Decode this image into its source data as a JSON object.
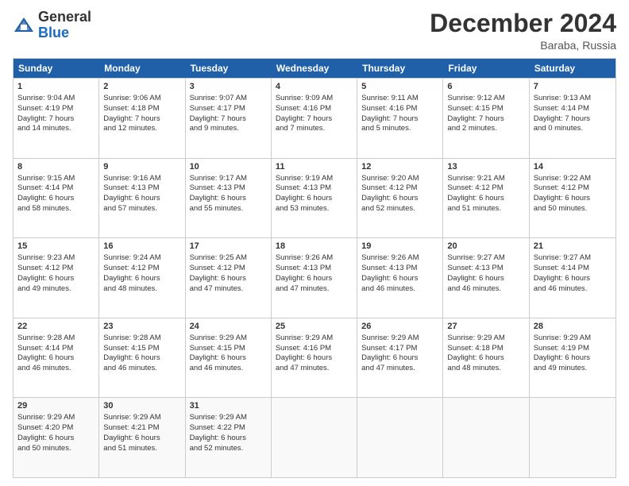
{
  "header": {
    "logo_general": "General",
    "logo_blue": "Blue",
    "month_title": "December 2024",
    "location": "Baraba, Russia"
  },
  "days_of_week": [
    "Sunday",
    "Monday",
    "Tuesday",
    "Wednesday",
    "Thursday",
    "Friday",
    "Saturday"
  ],
  "weeks": [
    [
      {
        "day": "1",
        "lines": [
          "Sunrise: 9:04 AM",
          "Sunset: 4:19 PM",
          "Daylight: 7 hours",
          "and 14 minutes."
        ]
      },
      {
        "day": "2",
        "lines": [
          "Sunrise: 9:06 AM",
          "Sunset: 4:18 PM",
          "Daylight: 7 hours",
          "and 12 minutes."
        ]
      },
      {
        "day": "3",
        "lines": [
          "Sunrise: 9:07 AM",
          "Sunset: 4:17 PM",
          "Daylight: 7 hours",
          "and 9 minutes."
        ]
      },
      {
        "day": "4",
        "lines": [
          "Sunrise: 9:09 AM",
          "Sunset: 4:16 PM",
          "Daylight: 7 hours",
          "and 7 minutes."
        ]
      },
      {
        "day": "5",
        "lines": [
          "Sunrise: 9:11 AM",
          "Sunset: 4:16 PM",
          "Daylight: 7 hours",
          "and 5 minutes."
        ]
      },
      {
        "day": "6",
        "lines": [
          "Sunrise: 9:12 AM",
          "Sunset: 4:15 PM",
          "Daylight: 7 hours",
          "and 2 minutes."
        ]
      },
      {
        "day": "7",
        "lines": [
          "Sunrise: 9:13 AM",
          "Sunset: 4:14 PM",
          "Daylight: 7 hours",
          "and 0 minutes."
        ]
      }
    ],
    [
      {
        "day": "8",
        "lines": [
          "Sunrise: 9:15 AM",
          "Sunset: 4:14 PM",
          "Daylight: 6 hours",
          "and 58 minutes."
        ]
      },
      {
        "day": "9",
        "lines": [
          "Sunrise: 9:16 AM",
          "Sunset: 4:13 PM",
          "Daylight: 6 hours",
          "and 57 minutes."
        ]
      },
      {
        "day": "10",
        "lines": [
          "Sunrise: 9:17 AM",
          "Sunset: 4:13 PM",
          "Daylight: 6 hours",
          "and 55 minutes."
        ]
      },
      {
        "day": "11",
        "lines": [
          "Sunrise: 9:19 AM",
          "Sunset: 4:13 PM",
          "Daylight: 6 hours",
          "and 53 minutes."
        ]
      },
      {
        "day": "12",
        "lines": [
          "Sunrise: 9:20 AM",
          "Sunset: 4:12 PM",
          "Daylight: 6 hours",
          "and 52 minutes."
        ]
      },
      {
        "day": "13",
        "lines": [
          "Sunrise: 9:21 AM",
          "Sunset: 4:12 PM",
          "Daylight: 6 hours",
          "and 51 minutes."
        ]
      },
      {
        "day": "14",
        "lines": [
          "Sunrise: 9:22 AM",
          "Sunset: 4:12 PM",
          "Daylight: 6 hours",
          "and 50 minutes."
        ]
      }
    ],
    [
      {
        "day": "15",
        "lines": [
          "Sunrise: 9:23 AM",
          "Sunset: 4:12 PM",
          "Daylight: 6 hours",
          "and 49 minutes."
        ]
      },
      {
        "day": "16",
        "lines": [
          "Sunrise: 9:24 AM",
          "Sunset: 4:12 PM",
          "Daylight: 6 hours",
          "and 48 minutes."
        ]
      },
      {
        "day": "17",
        "lines": [
          "Sunrise: 9:25 AM",
          "Sunset: 4:12 PM",
          "Daylight: 6 hours",
          "and 47 minutes."
        ]
      },
      {
        "day": "18",
        "lines": [
          "Sunrise: 9:26 AM",
          "Sunset: 4:13 PM",
          "Daylight: 6 hours",
          "and 47 minutes."
        ]
      },
      {
        "day": "19",
        "lines": [
          "Sunrise: 9:26 AM",
          "Sunset: 4:13 PM",
          "Daylight: 6 hours",
          "and 46 minutes."
        ]
      },
      {
        "day": "20",
        "lines": [
          "Sunrise: 9:27 AM",
          "Sunset: 4:13 PM",
          "Daylight: 6 hours",
          "and 46 minutes."
        ]
      },
      {
        "day": "21",
        "lines": [
          "Sunrise: 9:27 AM",
          "Sunset: 4:14 PM",
          "Daylight: 6 hours",
          "and 46 minutes."
        ]
      }
    ],
    [
      {
        "day": "22",
        "lines": [
          "Sunrise: 9:28 AM",
          "Sunset: 4:14 PM",
          "Daylight: 6 hours",
          "and 46 minutes."
        ]
      },
      {
        "day": "23",
        "lines": [
          "Sunrise: 9:28 AM",
          "Sunset: 4:15 PM",
          "Daylight: 6 hours",
          "and 46 minutes."
        ]
      },
      {
        "day": "24",
        "lines": [
          "Sunrise: 9:29 AM",
          "Sunset: 4:15 PM",
          "Daylight: 6 hours",
          "and 46 minutes."
        ]
      },
      {
        "day": "25",
        "lines": [
          "Sunrise: 9:29 AM",
          "Sunset: 4:16 PM",
          "Daylight: 6 hours",
          "and 47 minutes."
        ]
      },
      {
        "day": "26",
        "lines": [
          "Sunrise: 9:29 AM",
          "Sunset: 4:17 PM",
          "Daylight: 6 hours",
          "and 47 minutes."
        ]
      },
      {
        "day": "27",
        "lines": [
          "Sunrise: 9:29 AM",
          "Sunset: 4:18 PM",
          "Daylight: 6 hours",
          "and 48 minutes."
        ]
      },
      {
        "day": "28",
        "lines": [
          "Sunrise: 9:29 AM",
          "Sunset: 4:19 PM",
          "Daylight: 6 hours",
          "and 49 minutes."
        ]
      }
    ],
    [
      {
        "day": "29",
        "lines": [
          "Sunrise: 9:29 AM",
          "Sunset: 4:20 PM",
          "Daylight: 6 hours",
          "and 50 minutes."
        ]
      },
      {
        "day": "30",
        "lines": [
          "Sunrise: 9:29 AM",
          "Sunset: 4:21 PM",
          "Daylight: 6 hours",
          "and 51 minutes."
        ]
      },
      {
        "day": "31",
        "lines": [
          "Sunrise: 9:29 AM",
          "Sunset: 4:22 PM",
          "Daylight: 6 hours",
          "and 52 minutes."
        ]
      },
      {
        "day": "",
        "lines": []
      },
      {
        "day": "",
        "lines": []
      },
      {
        "day": "",
        "lines": []
      },
      {
        "day": "",
        "lines": []
      }
    ]
  ]
}
